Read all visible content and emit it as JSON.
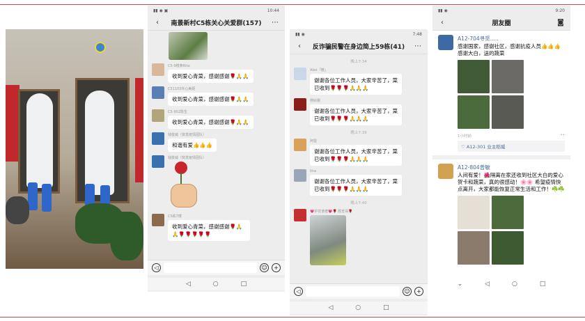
{
  "group_chat": {
    "status_time": "10:44",
    "title": "南景新村C5栋关心关爱群(157)",
    "messages": [
      {
        "nick": "C5-9楼黄Rita",
        "text": "收到爱心青菜，感谢感谢🌹🙏🙏"
      },
      {
        "nick": "C51103许心美妮",
        "text": "收到爱心青菜，感谢感谢🌹🙏🙏"
      },
      {
        "nick": "C5-902陈生",
        "text": "收到爱心青菜，感谢感谢🌹🙏🙏"
      },
      {
        "nick": "钱俊威（突发疫情团队）",
        "text": "和谐有爱👍👍👍"
      },
      {
        "nick": "钱俊威（突发疫情团队）",
        "text": ""
      },
      {
        "nick": "C5栋7楼",
        "text": "收到爱心青菜，感谢感谢🌹🙏🙏🌹🌹🌹🌹🌹"
      }
    ]
  },
  "antifraud_chat": {
    "status_time": "7:48",
    "title": "反诈骗民警在身边简上59栋(41)",
    "times": [
      "晚上7:34",
      "晚上7:39",
      "晚上7:40"
    ],
    "messages": [
      {
        "nick": "Alex「微」",
        "text": "谢谢各位工作人员，大家辛苦了，菜已收到🌹🌹🌹🙏🙏🙏"
      },
      {
        "nick": "杨好晨",
        "text": "谢谢各位工作人员，大家辛苦了，菜已收到🌹🌹🌹🙏🙏🙏"
      },
      {
        "nick": "阿雷",
        "text": "谢谢各位工作人员，大家辛苦了，菜已收到🌹🌹🌹🙏🙏🙏"
      },
      {
        "nick": "lina",
        "text": "谢谢各位工作人员，大家辛苦了，菜已收到🌹🌹🌹🙏🙏🙏"
      },
      {
        "nick": "💗护花使者💗🌹 胜宏哥🌹",
        "text": ""
      }
    ]
  },
  "moments": {
    "status_time": "9:20",
    "title": "朋友圈",
    "posts": [
      {
        "name": "A12-704寻觅.....",
        "text": "感谢国家，感谢社区，感谢抗疫人员👍👍👍感谢大白，送的蔬菜",
        "time": "1小时前",
        "likes": "♡ A12-301  业主稻城"
      },
      {
        "name": "A12-804曾敏",
        "text": "人间有爱！🌺隔离在家还收到社区大白的爱心贺卡和蔬菜，真的很感动！🌸🌸 希望疫情快点离开，大家都能恢复正常生活和工作！☘️☘️"
      }
    ]
  },
  "colors": {
    "rule": "#c0504d",
    "chat_bg": "#ededed",
    "bubble": "#ffffff",
    "link": "#4a6b9a"
  }
}
